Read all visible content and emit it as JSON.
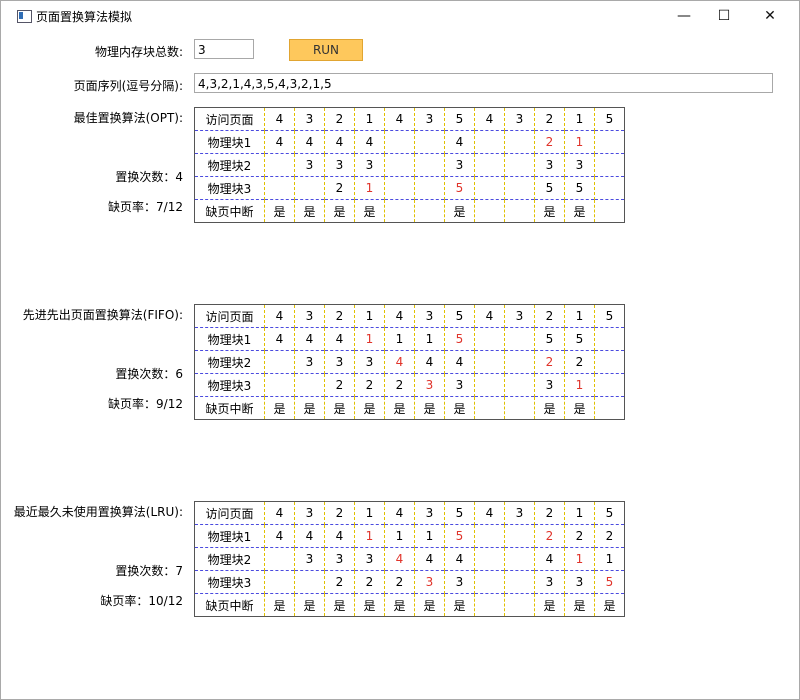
{
  "window": {
    "title": "页面置换算法模拟"
  },
  "form": {
    "mem_label": "物理内存块总数:",
    "mem_value": "3",
    "run_label": "RUN",
    "seq_label": "页面序列(逗号分隔):",
    "seq_value": "4,3,2,1,4,3,5,4,3,2,1,5"
  },
  "sections": [
    {
      "id": "opt",
      "label": "最佳置换算法(OPT):",
      "replace_label": "置换次数：4",
      "fault_label": "缺页率：7/12",
      "rows": [
        {
          "header": "访问页面",
          "cells": [
            {
              "v": "4"
            },
            {
              "v": "3"
            },
            {
              "v": "2"
            },
            {
              "v": "1"
            },
            {
              "v": "4"
            },
            {
              "v": "3"
            },
            {
              "v": "5"
            },
            {
              "v": "4"
            },
            {
              "v": "3"
            },
            {
              "v": "2"
            },
            {
              "v": "1"
            },
            {
              "v": "5"
            }
          ]
        },
        {
          "header": "物理块1",
          "cells": [
            {
              "v": "4"
            },
            {
              "v": "4"
            },
            {
              "v": "4"
            },
            {
              "v": "4"
            },
            {
              "v": ""
            },
            {
              "v": ""
            },
            {
              "v": "4"
            },
            {
              "v": ""
            },
            {
              "v": ""
            },
            {
              "v": "2",
              "red": true
            },
            {
              "v": "1",
              "red": true
            },
            {
              "v": ""
            }
          ]
        },
        {
          "header": "物理块2",
          "cells": [
            {
              "v": ""
            },
            {
              "v": "3"
            },
            {
              "v": "3"
            },
            {
              "v": "3"
            },
            {
              "v": ""
            },
            {
              "v": ""
            },
            {
              "v": "3"
            },
            {
              "v": ""
            },
            {
              "v": ""
            },
            {
              "v": "3"
            },
            {
              "v": "3"
            },
            {
              "v": ""
            }
          ]
        },
        {
          "header": "物理块3",
          "cells": [
            {
              "v": ""
            },
            {
              "v": ""
            },
            {
              "v": "2"
            },
            {
              "v": "1",
              "red": true
            },
            {
              "v": ""
            },
            {
              "v": ""
            },
            {
              "v": "5",
              "red": true
            },
            {
              "v": ""
            },
            {
              "v": ""
            },
            {
              "v": "5"
            },
            {
              "v": "5"
            },
            {
              "v": ""
            }
          ]
        },
        {
          "header": "缺页中断",
          "cells": [
            {
              "v": "是"
            },
            {
              "v": "是"
            },
            {
              "v": "是"
            },
            {
              "v": "是"
            },
            {
              "v": ""
            },
            {
              "v": ""
            },
            {
              "v": "是"
            },
            {
              "v": ""
            },
            {
              "v": ""
            },
            {
              "v": "是"
            },
            {
              "v": "是"
            },
            {
              "v": ""
            }
          ]
        }
      ]
    },
    {
      "id": "fifo",
      "label": "先进先出页面置换算法(FIFO):",
      "replace_label": "置换次数：6",
      "fault_label": "缺页率：9/12",
      "rows": [
        {
          "header": "访问页面",
          "cells": [
            {
              "v": "4"
            },
            {
              "v": "3"
            },
            {
              "v": "2"
            },
            {
              "v": "1"
            },
            {
              "v": "4"
            },
            {
              "v": "3"
            },
            {
              "v": "5"
            },
            {
              "v": "4"
            },
            {
              "v": "3"
            },
            {
              "v": "2"
            },
            {
              "v": "1"
            },
            {
              "v": "5"
            }
          ]
        },
        {
          "header": "物理块1",
          "cells": [
            {
              "v": "4"
            },
            {
              "v": "4"
            },
            {
              "v": "4"
            },
            {
              "v": "1",
              "red": true
            },
            {
              "v": "1"
            },
            {
              "v": "1"
            },
            {
              "v": "5",
              "red": true
            },
            {
              "v": ""
            },
            {
              "v": ""
            },
            {
              "v": "5"
            },
            {
              "v": "5"
            },
            {
              "v": ""
            }
          ]
        },
        {
          "header": "物理块2",
          "cells": [
            {
              "v": ""
            },
            {
              "v": "3"
            },
            {
              "v": "3"
            },
            {
              "v": "3"
            },
            {
              "v": "4",
              "red": true
            },
            {
              "v": "4"
            },
            {
              "v": "4"
            },
            {
              "v": ""
            },
            {
              "v": ""
            },
            {
              "v": "2",
              "red": true
            },
            {
              "v": "2"
            },
            {
              "v": ""
            }
          ]
        },
        {
          "header": "物理块3",
          "cells": [
            {
              "v": ""
            },
            {
              "v": ""
            },
            {
              "v": "2"
            },
            {
              "v": "2"
            },
            {
              "v": "2"
            },
            {
              "v": "3",
              "red": true
            },
            {
              "v": "3"
            },
            {
              "v": ""
            },
            {
              "v": ""
            },
            {
              "v": "3"
            },
            {
              "v": "1",
              "red": true
            },
            {
              "v": ""
            }
          ]
        },
        {
          "header": "缺页中断",
          "cells": [
            {
              "v": "是"
            },
            {
              "v": "是"
            },
            {
              "v": "是"
            },
            {
              "v": "是"
            },
            {
              "v": "是"
            },
            {
              "v": "是"
            },
            {
              "v": "是"
            },
            {
              "v": ""
            },
            {
              "v": ""
            },
            {
              "v": "是"
            },
            {
              "v": "是"
            },
            {
              "v": ""
            }
          ]
        }
      ]
    },
    {
      "id": "lru",
      "label": "最近最久未使用置换算法(LRU):",
      "replace_label": "置换次数：7",
      "fault_label": "缺页率：10/12",
      "rows": [
        {
          "header": "访问页面",
          "cells": [
            {
              "v": "4"
            },
            {
              "v": "3"
            },
            {
              "v": "2"
            },
            {
              "v": "1"
            },
            {
              "v": "4"
            },
            {
              "v": "3"
            },
            {
              "v": "5"
            },
            {
              "v": "4"
            },
            {
              "v": "3"
            },
            {
              "v": "2"
            },
            {
              "v": "1"
            },
            {
              "v": "5"
            }
          ]
        },
        {
          "header": "物理块1",
          "cells": [
            {
              "v": "4"
            },
            {
              "v": "4"
            },
            {
              "v": "4"
            },
            {
              "v": "1",
              "red": true
            },
            {
              "v": "1"
            },
            {
              "v": "1"
            },
            {
              "v": "5",
              "red": true
            },
            {
              "v": ""
            },
            {
              "v": ""
            },
            {
              "v": "2",
              "red": true
            },
            {
              "v": "2"
            },
            {
              "v": "2"
            }
          ]
        },
        {
          "header": "物理块2",
          "cells": [
            {
              "v": ""
            },
            {
              "v": "3"
            },
            {
              "v": "3"
            },
            {
              "v": "3"
            },
            {
              "v": "4",
              "red": true
            },
            {
              "v": "4"
            },
            {
              "v": "4"
            },
            {
              "v": ""
            },
            {
              "v": ""
            },
            {
              "v": "4"
            },
            {
              "v": "1",
              "red": true
            },
            {
              "v": "1"
            }
          ]
        },
        {
          "header": "物理块3",
          "cells": [
            {
              "v": ""
            },
            {
              "v": ""
            },
            {
              "v": "2"
            },
            {
              "v": "2"
            },
            {
              "v": "2"
            },
            {
              "v": "3",
              "red": true
            },
            {
              "v": "3"
            },
            {
              "v": ""
            },
            {
              "v": ""
            },
            {
              "v": "3"
            },
            {
              "v": "3"
            },
            {
              "v": "5",
              "red": true
            }
          ]
        },
        {
          "header": "缺页中断",
          "cells": [
            {
              "v": "是"
            },
            {
              "v": "是"
            },
            {
              "v": "是"
            },
            {
              "v": "是"
            },
            {
              "v": "是"
            },
            {
              "v": "是"
            },
            {
              "v": "是"
            },
            {
              "v": ""
            },
            {
              "v": ""
            },
            {
              "v": "是"
            },
            {
              "v": "是"
            },
            {
              "v": "是"
            }
          ]
        }
      ]
    }
  ]
}
